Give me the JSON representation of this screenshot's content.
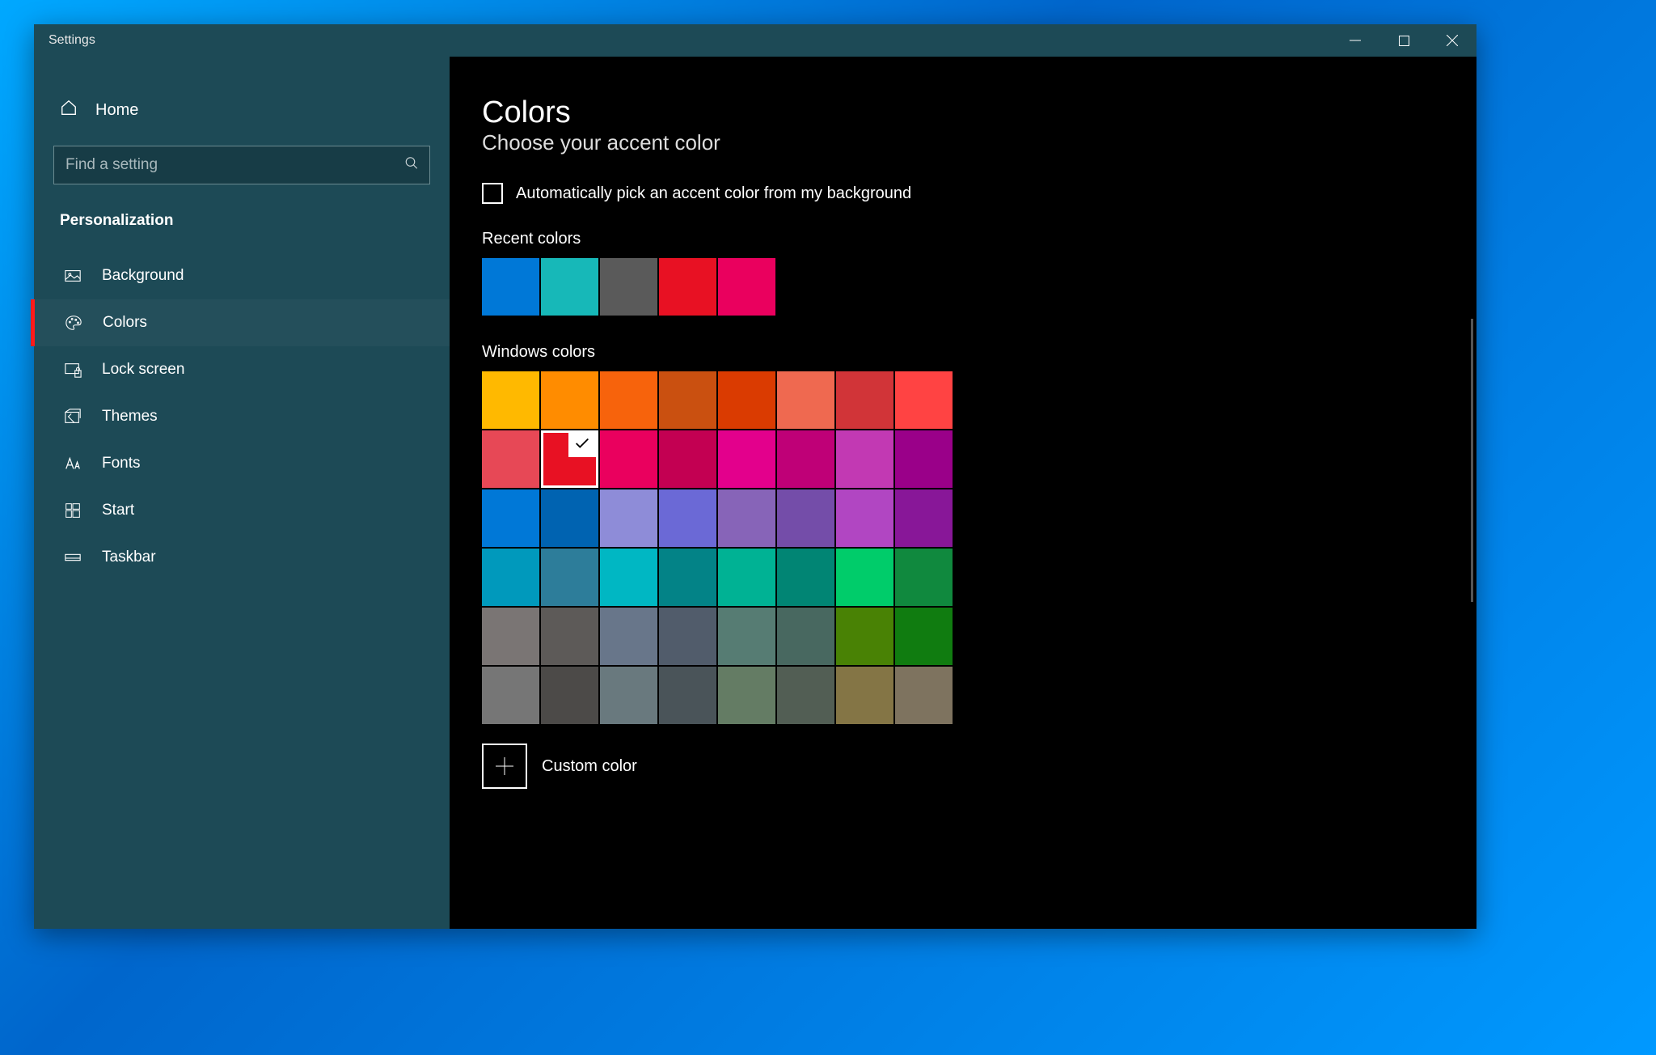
{
  "window": {
    "title": "Settings"
  },
  "sidebar": {
    "home_label": "Home",
    "search_placeholder": "Find a setting",
    "category": "Personalization",
    "items": [
      {
        "label": "Background",
        "active": false
      },
      {
        "label": "Colors",
        "active": true
      },
      {
        "label": "Lock screen",
        "active": false
      },
      {
        "label": "Themes",
        "active": false
      },
      {
        "label": "Fonts",
        "active": false
      },
      {
        "label": "Start",
        "active": false
      },
      {
        "label": "Taskbar",
        "active": false
      }
    ]
  },
  "main": {
    "title": "Colors",
    "subtitle": "Choose your accent color",
    "auto_pick_label": "Automatically pick an accent color from my background",
    "auto_pick_checked": false,
    "recent_label": "Recent colors",
    "recent_colors": [
      "#0078d7",
      "#17b8b8",
      "#5a5a5a",
      "#e81123",
      "#ea005e"
    ],
    "windows_label": "Windows colors",
    "windows_colors": [
      "#ffb900",
      "#ff8c00",
      "#f7630c",
      "#ca5010",
      "#da3b01",
      "#ef6950",
      "#d13438",
      "#ff4343",
      "#e74856",
      "#e81123",
      "#ea005e",
      "#c30052",
      "#e3008c",
      "#bf0077",
      "#c239b3",
      "#9a0089",
      "#0078d7",
      "#0063b1",
      "#8e8cd8",
      "#6b69d6",
      "#8764b8",
      "#744da9",
      "#b146c2",
      "#881798",
      "#0099bc",
      "#2d7d9a",
      "#00b7c3",
      "#038387",
      "#00b294",
      "#018574",
      "#00cc6a",
      "#10893e",
      "#7a7574",
      "#5d5a58",
      "#68768a",
      "#515c6b",
      "#567c73",
      "#486860",
      "#498205",
      "#107c10",
      "#767676",
      "#4c4a48",
      "#69797e",
      "#4a5459",
      "#647c64",
      "#525e54",
      "#847545",
      "#7e735f"
    ],
    "selected_index": 9,
    "custom_label": "Custom color"
  }
}
